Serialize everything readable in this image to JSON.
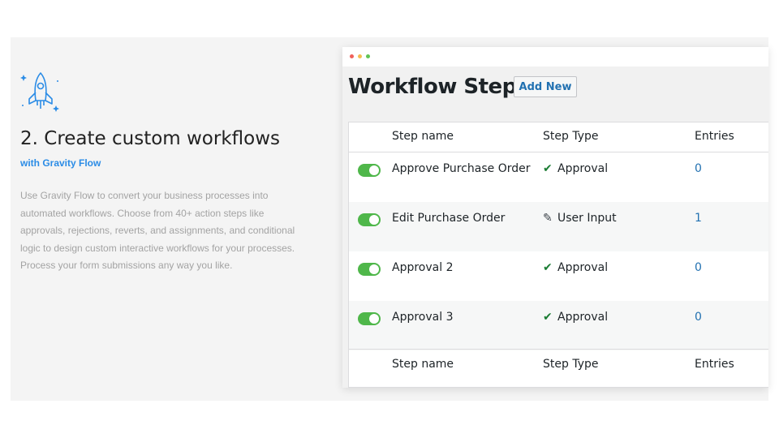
{
  "left": {
    "heading": "2. Create custom workflows",
    "subheading": "with Gravity Flow",
    "description_lines": [
      "Use Gravity Flow to convert your business processes into",
      "automated workflows. Choose from 40+ action steps like",
      "approvals, rejections, reverts, and assignments, and conditional",
      "logic to design custom interactive workflows for your processes.",
      "Process your form submissions any way you like."
    ],
    "icon": "rocket-icon"
  },
  "window": {
    "dot_colors": [
      "#f0605a",
      "#f5bd4f",
      "#61c454"
    ],
    "title": "Workflow Steps",
    "add_new_label": "Add New",
    "columns": [
      "Step name",
      "Step Type",
      "Entries"
    ],
    "rows": [
      {
        "enabled": true,
        "name": "Approve Purchase Order",
        "type_icon": "checkmark-icon",
        "type_glyph": "✔",
        "type": "Approval",
        "entries": "0"
      },
      {
        "enabled": true,
        "name": "Edit Purchase Order",
        "type_icon": "pencil-icon",
        "type_glyph": "✎",
        "type": "User Input",
        "entries": "1"
      },
      {
        "enabled": true,
        "name": "Approval 2",
        "type_icon": "checkmark-icon",
        "type_glyph": "✔",
        "type": "Approval",
        "entries": "0"
      },
      {
        "enabled": true,
        "name": "Approval 3",
        "type_icon": "checkmark-icon",
        "type_glyph": "✔",
        "type": "Approval",
        "entries": "0"
      }
    ]
  },
  "colors": {
    "toggle_on": "#4fb74a",
    "link": "#2271b1",
    "subheading": "#2b8ce6"
  }
}
